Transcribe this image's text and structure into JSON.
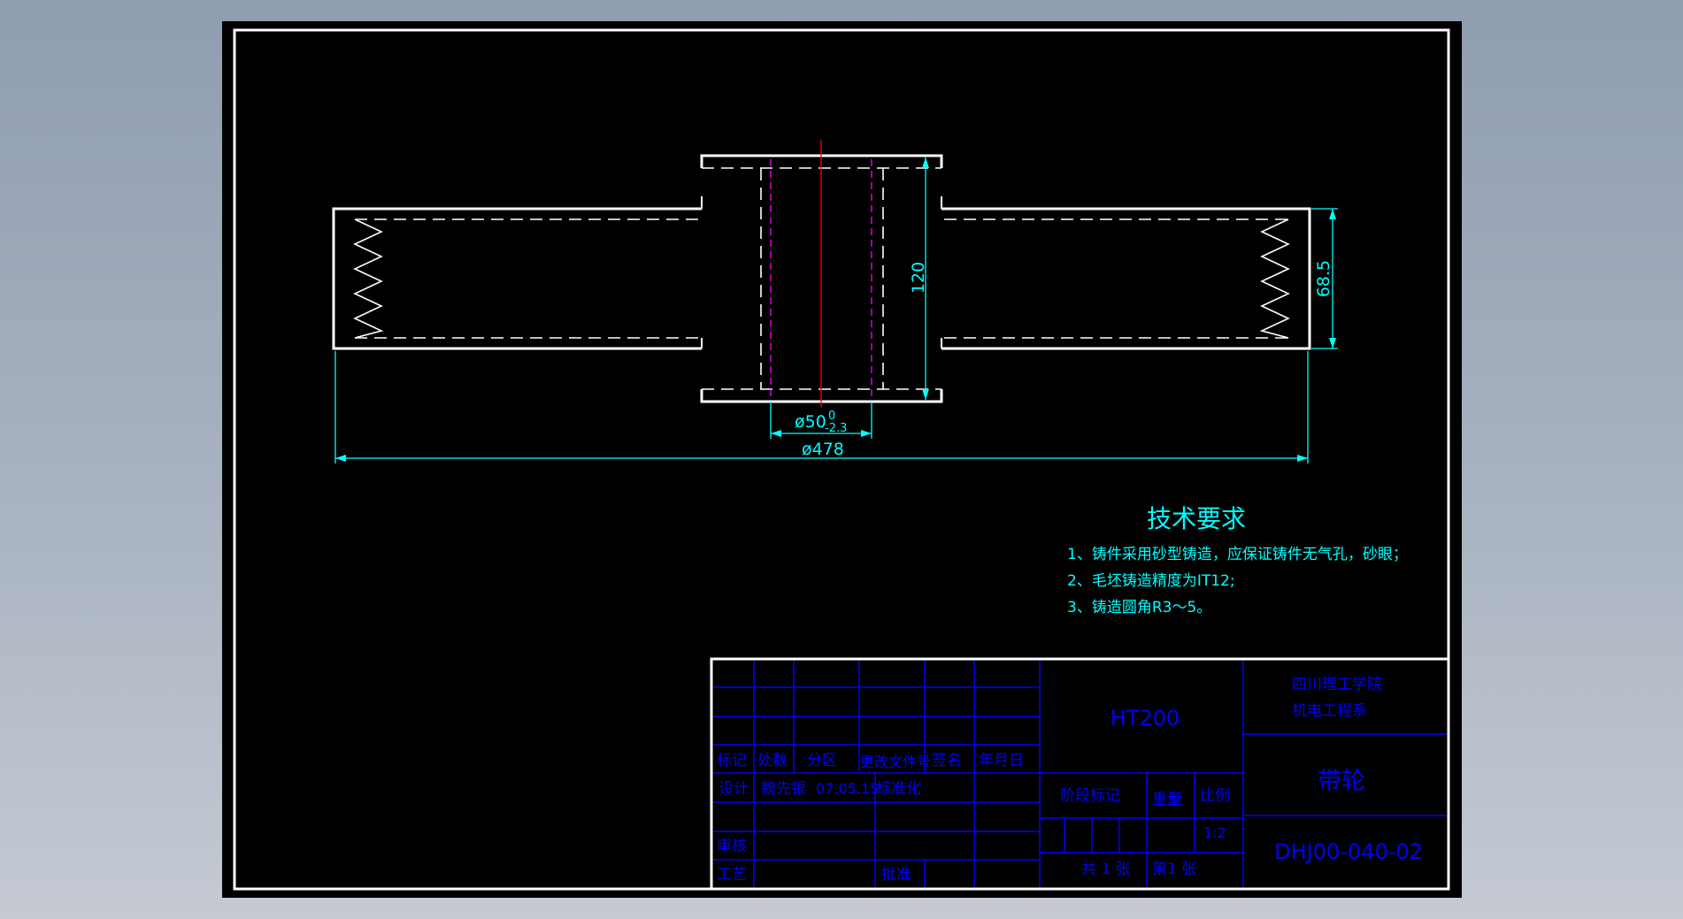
{
  "drawing": {
    "dimensions": {
      "height_120": "120",
      "height_68_5": "68.5",
      "bore_diameter": "ø50",
      "bore_tol_upper": "0",
      "bore_tol_lower": "-2.3",
      "outer_diameter": "ø478"
    },
    "tech_requirements": {
      "title": "技术要求",
      "items": [
        "1、铸件采用砂型铸造，应保证铸件无气孔，砂眼；",
        "2、毛坯铸造精度为IT12;",
        "3、铸造圆角R3～5。"
      ]
    },
    "title_block": {
      "material": "HT200",
      "school_line1": "四川理工学院",
      "school_line2": "机电工程系",
      "part_name": "带轮",
      "drawing_number": "DHJ00-040-02",
      "headers": {
        "mark": "标记",
        "count": "处数",
        "zone": "分区",
        "change_doc": "更改文件号",
        "signature": "签名",
        "date": "年月日"
      },
      "design_label": "设计",
      "designer": "魏先银",
      "design_date": "07.05.15",
      "standardize_label": "标准化",
      "review_label": "审核",
      "process_label": "工艺",
      "approve_label": "批准",
      "stage_mark": "阶段标记",
      "weight": "重量",
      "scale_label": "比例",
      "scale_value": "1:2",
      "sheets_total": "共 1 张",
      "sheet_number": "第1 张"
    },
    "colors": {
      "paper": "#000000",
      "outline": "#ffffff",
      "dimension": "#00ffff",
      "center_line": "#ff0000",
      "hidden_bore": "#ff00ff",
      "title_block": "#0000ff"
    }
  }
}
